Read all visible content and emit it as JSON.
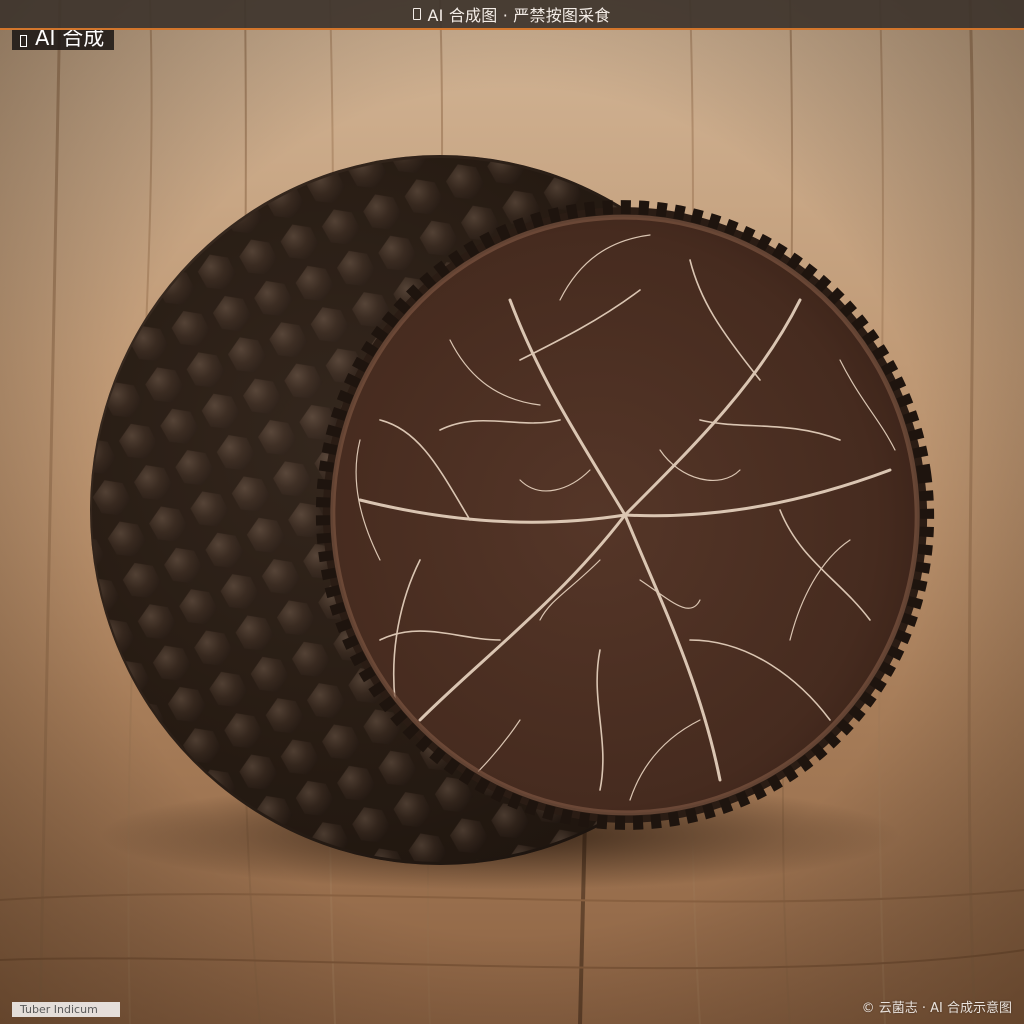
{
  "banner": {
    "text": "AI 合成图 · 严禁按图采食",
    "icon": "notice-icon"
  },
  "badge": {
    "text": "AI 合成",
    "icon": "notice-icon"
  },
  "caption": {
    "text": "Tuber Indicum"
  },
  "credit": {
    "text": "© 云菌志 · AI 合成示意图"
  },
  "colors": {
    "banner_bg": "#3e342c",
    "banner_accent": "#d3762c",
    "wood": "#b58f6b",
    "truffle_skin": "#2e2119",
    "truffle_flesh": "#4a2f22",
    "truffle_veins": "#ead6c2"
  }
}
